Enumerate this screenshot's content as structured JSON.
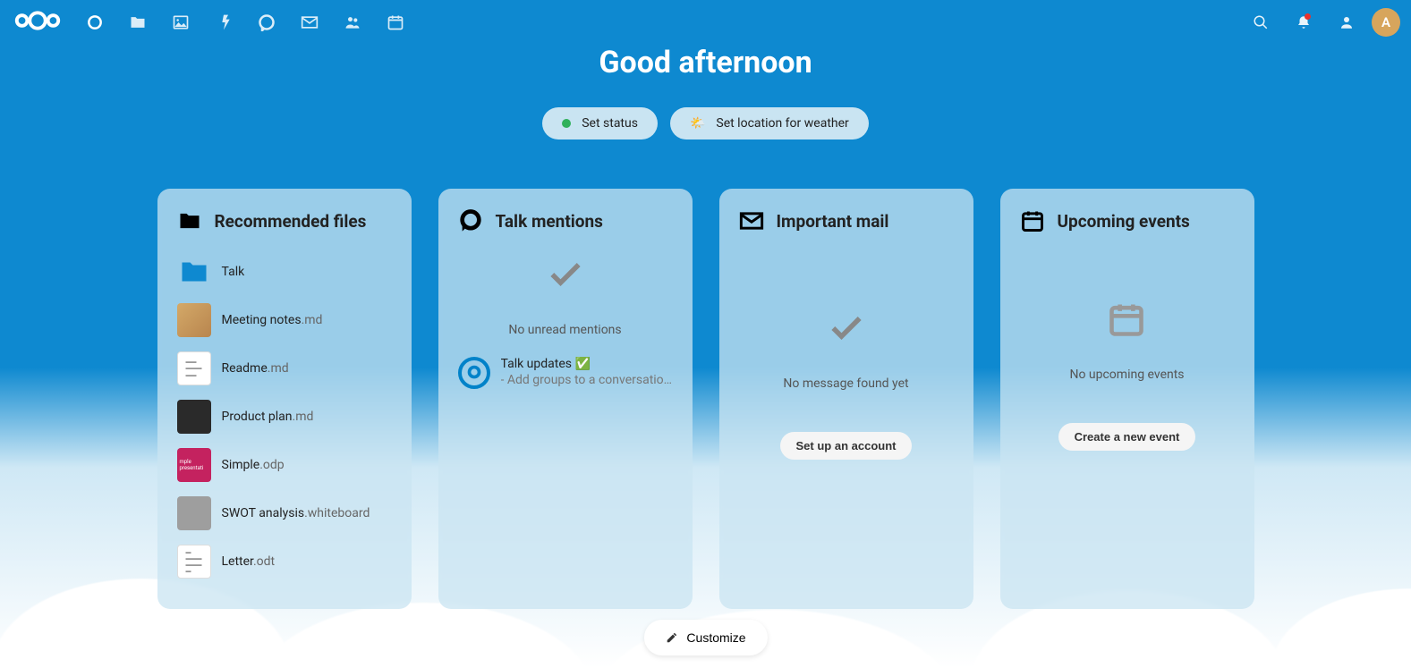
{
  "greeting": "Good afternoon",
  "status_pill": {
    "label": "Set status"
  },
  "weather_pill": {
    "label": "Set location for weather"
  },
  "avatar_initial": "A",
  "widgets": {
    "recommended": {
      "title": "Recommended files",
      "files": [
        {
          "name": "Talk",
          "ext": ""
        },
        {
          "name": "Meeting notes",
          "ext": ".md"
        },
        {
          "name": "Readme",
          "ext": ".md"
        },
        {
          "name": "Product plan",
          "ext": ".md"
        },
        {
          "name": "Simple",
          "ext": ".odp"
        },
        {
          "name": "SWOT analysis",
          "ext": ".whiteboard"
        },
        {
          "name": "Letter",
          "ext": ".odt"
        }
      ]
    },
    "talk": {
      "title": "Talk mentions",
      "empty_text": "No unread mentions",
      "item": {
        "title": "Talk updates ✅",
        "subtitle": "- Add groups to a conversation …"
      }
    },
    "mail": {
      "title": "Important mail",
      "empty_text": "No message found yet",
      "action": "Set up an account"
    },
    "events": {
      "title": "Upcoming events",
      "empty_text": "No upcoming events",
      "action": "Create a new event"
    }
  },
  "customize_label": "Customize"
}
